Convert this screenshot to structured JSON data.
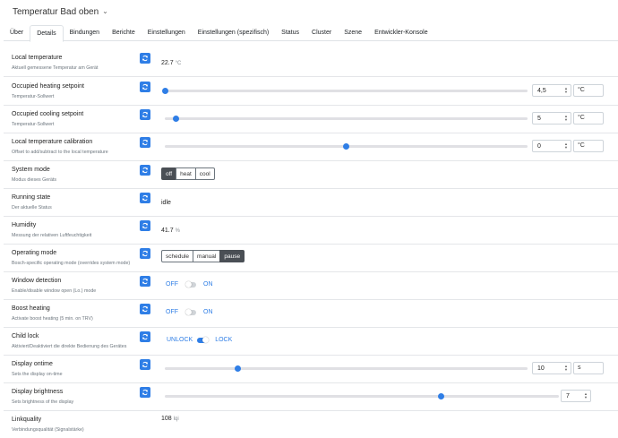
{
  "header": {
    "title": "Temperatur Bad oben"
  },
  "tabs": [
    "Über",
    "Details",
    "Bindungen",
    "Berichte",
    "Einstellungen",
    "Einstellungen (spezifisch)",
    "Status",
    "Cluster",
    "Szene",
    "Entwickler-Konsole"
  ],
  "active_tab": "Details",
  "accent_color": "#2f7ee6",
  "rows": {
    "local_temperature": {
      "label": "Local temperature",
      "desc": "Aktuell gemessene Temperatur am Gerät",
      "value": "22.7",
      "unit": "°C"
    },
    "occupied_heating": {
      "label": "Occupied heating setpoint",
      "desc": "Temperatur-Sollwert",
      "value": "4,5",
      "unit": "°C",
      "level": 0.0
    },
    "occupied_cooling": {
      "label": "Occupied cooling setpoint",
      "desc": "Temperatur-Sollwert",
      "value": "5",
      "unit": "°C",
      "level": 0.03
    },
    "calibration": {
      "label": "Local temperature calibration",
      "desc": "Offset to add/subtract to the local temperature",
      "value": "0",
      "unit": "°C",
      "level": 0.5
    },
    "system_mode": {
      "label": "System mode",
      "desc": "Modus dieses Geräts",
      "options": [
        "off",
        "heat",
        "cool"
      ],
      "selected": "off"
    },
    "running_state": {
      "label": "Running state",
      "desc": "Der aktuelle Status",
      "value": "idle"
    },
    "humidity": {
      "label": "Humidity",
      "desc": "Messung der relativen Luftfeuchtigkeit",
      "value": "41.7",
      "unit": "%"
    },
    "operating_mode": {
      "label": "Operating mode",
      "desc": "Bosch-specific operating mode (overrides system mode)",
      "options": [
        "schedule",
        "manual",
        "pause"
      ],
      "selected": "pause"
    },
    "window_detection": {
      "label": "Window detection",
      "desc": "Enable/disable window open (Lo.) mode",
      "off_label": "OFF",
      "on_label": "ON",
      "state": "off"
    },
    "boost_heating": {
      "label": "Boost heating",
      "desc": "Activate boost heating (5 min. on TRV)",
      "off_label": "OFF",
      "on_label": "ON",
      "state": "off"
    },
    "child_lock": {
      "label": "Child lock",
      "desc": "Aktiviert/Deaktiviert die direkte Bedienung des Gerätes",
      "off_label": "UNLOCK",
      "on_label": "LOCK",
      "state": "on"
    },
    "display_ontime": {
      "label": "Display ontime",
      "desc": "Sets the display on-time",
      "value": "10",
      "unit": "s",
      "level": 0.2
    },
    "display_brightness": {
      "label": "Display brightness",
      "desc": "Sets brightness of the display",
      "value": "7",
      "level": 0.7
    },
    "linkquality": {
      "label": "Linkquality",
      "desc": "Verbindungsqualität (Signalstärke)",
      "value": "108",
      "unit": "lqi"
    }
  }
}
